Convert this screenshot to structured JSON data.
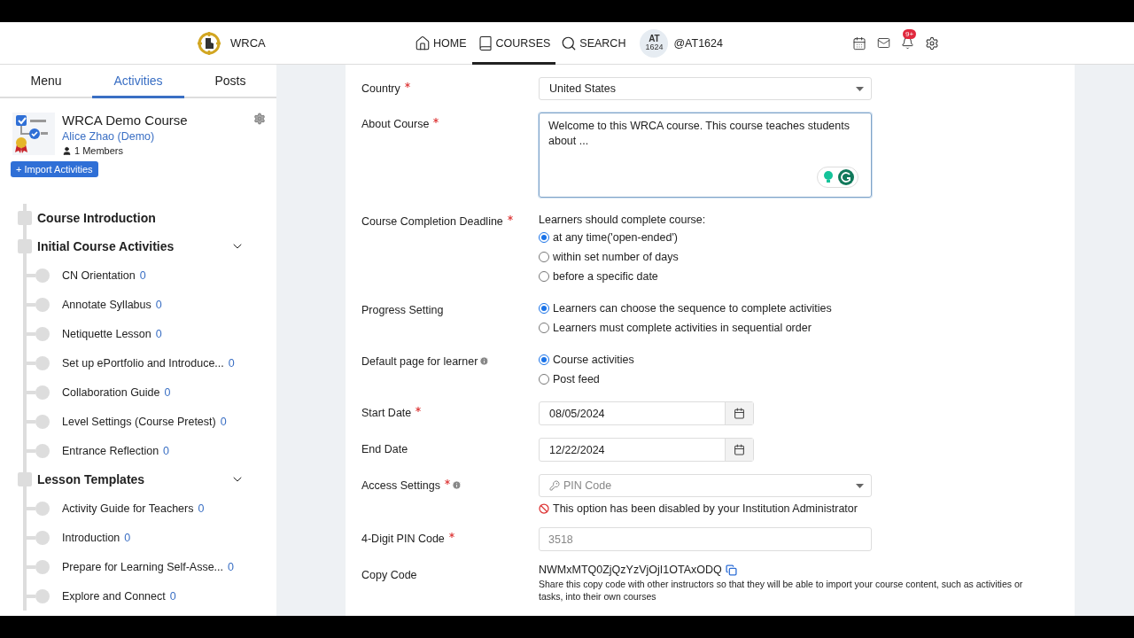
{
  "header": {
    "brand": "WRCA",
    "nav": [
      {
        "label": "HOME",
        "selected": false
      },
      {
        "label": "COURSES",
        "selected": true
      },
      {
        "label": "SEARCH",
        "selected": false
      }
    ],
    "user": {
      "initials": "AT",
      "number": "1624",
      "handle": "@AT1624"
    },
    "notification_badge": "9+"
  },
  "sidebar": {
    "tabs": [
      {
        "label": "Menu",
        "selected": false
      },
      {
        "label": "Activities",
        "selected": true
      },
      {
        "label": "Posts",
        "selected": false
      }
    ],
    "course": {
      "title": "WRCA Demo Course",
      "owner": "Alice Zhao (Demo)",
      "members": "1 Members"
    },
    "import_button": "+ Import Activities",
    "sections": [
      {
        "title": "Course Introduction"
      },
      {
        "title": "Initial Course Activities",
        "children": [
          {
            "name": "CN Orientation",
            "count": "0"
          },
          {
            "name": "Annotate Syllabus",
            "count": "0"
          },
          {
            "name": "Netiquette Lesson",
            "count": "0"
          },
          {
            "name": "Set up ePortfolio and Introduce...",
            "count": "0"
          },
          {
            "name": "Collaboration Guide",
            "count": "0"
          },
          {
            "name": "Level Settings (Course Pretest)",
            "count": "0"
          },
          {
            "name": "Entrance Reflection",
            "count": "0"
          }
        ]
      },
      {
        "title": "Lesson Templates",
        "children": [
          {
            "name": "Activity Guide for Teachers",
            "count": "0"
          },
          {
            "name": "Introduction",
            "count": "0"
          },
          {
            "name": "Prepare for Learning Self-Asse...",
            "count": "0"
          },
          {
            "name": "Explore and Connect",
            "count": "0"
          }
        ]
      }
    ]
  },
  "form": [
    {
      "kind": "select",
      "label": "Country",
      "required": true,
      "value": "United States",
      "disabled": false
    },
    {
      "kind": "textarea",
      "label": "About Course",
      "required": true,
      "value": "Welcome to this WRCA course. This course teaches students about ..."
    },
    {
      "kind": "radio",
      "label": "Course Completion Deadline",
      "required": true,
      "prompt": "Learners should complete course:",
      "options": [
        {
          "label": "at any time('open-ended')",
          "selected": true
        },
        {
          "label": "within set number of days",
          "selected": false
        },
        {
          "label": "before a specific date",
          "selected": false
        }
      ]
    },
    {
      "kind": "radio",
      "label": "Progress Setting",
      "required": false,
      "options": [
        {
          "label": "Learners can choose the sequence to complete activities",
          "selected": true
        },
        {
          "label": "Learners must complete activities in sequential order",
          "selected": false
        }
      ]
    },
    {
      "kind": "radio",
      "label": "Default page for learner",
      "required": false,
      "info": true,
      "options": [
        {
          "label": "Course activities",
          "selected": true
        },
        {
          "label": "Post feed",
          "selected": false
        }
      ]
    },
    {
      "kind": "date",
      "label": "Start Date",
      "required": true,
      "value": "08/05/2024"
    },
    {
      "kind": "date",
      "label": "End Date",
      "required": false,
      "value": "12/22/2024"
    },
    {
      "kind": "select",
      "label": "Access Settings",
      "required": true,
      "info": true,
      "value": "PIN Code",
      "disabled": true,
      "notice": "This option has been disabled by your Institution Administrator"
    },
    {
      "kind": "text",
      "label": "4-Digit PIN Code",
      "required": true,
      "placeholder": "3518"
    },
    {
      "kind": "code",
      "label": "Copy Code",
      "required": false,
      "value": "NWMxMTQ0ZjQzYzVjOjI1OTAxODQ",
      "help": "Share this copy code with other instructors so that they will be able to import your course content, such as activities or tasks, into their own courses"
    }
  ]
}
